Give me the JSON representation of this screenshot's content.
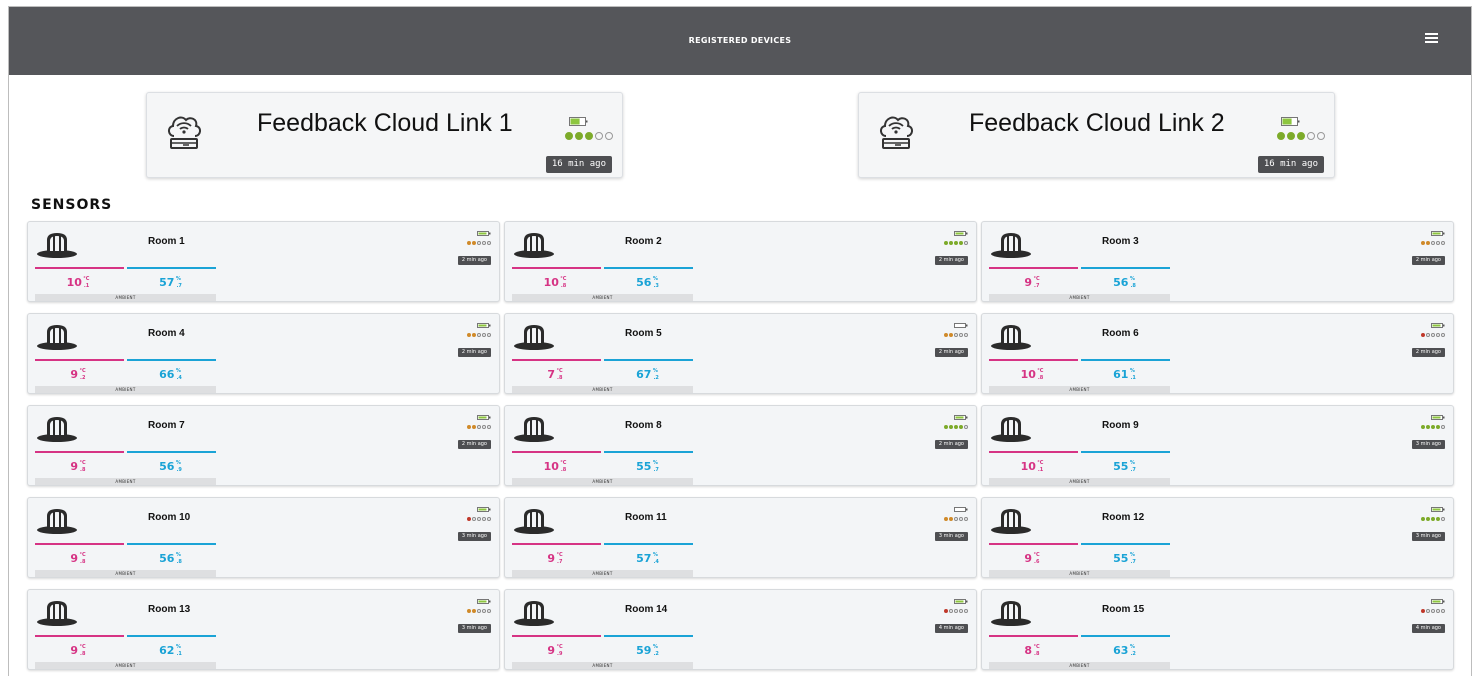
{
  "header": {
    "title": "REGISTERED DEVICES",
    "menu_icon": "hamburger-menu-icon"
  },
  "gateways": [
    {
      "name": "Feedback Cloud Link 1",
      "last_seen": "16 min ago",
      "battery": 0.7,
      "signal": 3,
      "icon": "cloud-wifi-router-icon"
    },
    {
      "name": "Feedback Cloud Link 2",
      "last_seen": "16 min ago",
      "battery": 0.7,
      "signal": 3,
      "icon": "cloud-wifi-router-icon"
    }
  ],
  "section_title": "SENSORS",
  "colors": {
    "temperature": "#d63384",
    "humidity": "#1aa3d6",
    "signal_green": "#7dab2a",
    "signal_orange": "#d08a2a",
    "signal_red": "#c0392b",
    "battery_green": "#8dc63f"
  },
  "sensors": [
    {
      "name": "Room 1",
      "temp": "10",
      "temp_dec": ".1",
      "temp_unit": "°C",
      "hum": "57",
      "hum_dec": ".7",
      "hum_unit": "%",
      "label": "AMBIENT",
      "last_seen": "2 min ago",
      "battery": 1.0,
      "signal": 2
    },
    {
      "name": "Room 2",
      "temp": "10",
      "temp_dec": ".8",
      "temp_unit": "°C",
      "hum": "56",
      "hum_dec": ".3",
      "hum_unit": "%",
      "label": "AMBIENT",
      "last_seen": "2 min ago",
      "battery": 1.0,
      "signal": 4
    },
    {
      "name": "Room 3",
      "temp": "9",
      "temp_dec": ".7",
      "temp_unit": "°C",
      "hum": "56",
      "hum_dec": ".8",
      "hum_unit": "%",
      "label": "AMBIENT",
      "last_seen": "2 min ago",
      "battery": 1.0,
      "signal": 2
    },
    {
      "name": "Room 4",
      "temp": "9",
      "temp_dec": ".2",
      "temp_unit": "°C",
      "hum": "66",
      "hum_dec": ".4",
      "hum_unit": "%",
      "label": "AMBIENT",
      "last_seen": "2 min ago",
      "battery": 1.0,
      "signal": 2
    },
    {
      "name": "Room 5",
      "temp": "7",
      "temp_dec": ".8",
      "temp_unit": "°C",
      "hum": "67",
      "hum_dec": ".2",
      "hum_unit": "%",
      "label": "AMBIENT",
      "last_seen": "2 min ago",
      "battery": 0.4,
      "signal": 2
    },
    {
      "name": "Room 6",
      "temp": "10",
      "temp_dec": ".8",
      "temp_unit": "°C",
      "hum": "61",
      "hum_dec": ".1",
      "hum_unit": "%",
      "label": "AMBIENT",
      "last_seen": "2 min ago",
      "battery": 1.0,
      "signal": 1
    },
    {
      "name": "Room 7",
      "temp": "9",
      "temp_dec": ".8",
      "temp_unit": "°C",
      "hum": "56",
      "hum_dec": ".9",
      "hum_unit": "%",
      "label": "AMBIENT",
      "last_seen": "2 min ago",
      "battery": 1.0,
      "signal": 2
    },
    {
      "name": "Room 8",
      "temp": "10",
      "temp_dec": ".8",
      "temp_unit": "°C",
      "hum": "55",
      "hum_dec": ".7",
      "hum_unit": "%",
      "label": "AMBIENT",
      "last_seen": "2 min ago",
      "battery": 1.0,
      "signal": 4
    },
    {
      "name": "Room 9",
      "temp": "10",
      "temp_dec": ".1",
      "temp_unit": "°C",
      "hum": "55",
      "hum_dec": ".7",
      "hum_unit": "%",
      "label": "AMBIENT",
      "last_seen": "3 min ago",
      "battery": 1.0,
      "signal": 4
    },
    {
      "name": "Room 10",
      "temp": "9",
      "temp_dec": ".8",
      "temp_unit": "°C",
      "hum": "56",
      "hum_dec": ".8",
      "hum_unit": "%",
      "label": "AMBIENT",
      "last_seen": "3 min ago",
      "battery": 1.0,
      "signal": 1
    },
    {
      "name": "Room 11",
      "temp": "9",
      "temp_dec": ".7",
      "temp_unit": "°C",
      "hum": "57",
      "hum_dec": ".4",
      "hum_unit": "%",
      "label": "AMBIENT",
      "last_seen": "3 min ago",
      "battery": 0.3,
      "signal": 2
    },
    {
      "name": "Room 12",
      "temp": "9",
      "temp_dec": ".6",
      "temp_unit": "°C",
      "hum": "55",
      "hum_dec": ".7",
      "hum_unit": "%",
      "label": "AMBIENT",
      "last_seen": "3 min ago",
      "battery": 1.0,
      "signal": 4
    },
    {
      "name": "Room 13",
      "temp": "9",
      "temp_dec": ".8",
      "temp_unit": "°C",
      "hum": "62",
      "hum_dec": ".1",
      "hum_unit": "%",
      "label": "AMBIENT",
      "last_seen": "3 min ago",
      "battery": 1.0,
      "signal": 2
    },
    {
      "name": "Room 14",
      "temp": "9",
      "temp_dec": ".9",
      "temp_unit": "°C",
      "hum": "59",
      "hum_dec": ".2",
      "hum_unit": "%",
      "label": "AMBIENT",
      "last_seen": "4 min ago",
      "battery": 1.0,
      "signal": 1
    },
    {
      "name": "Room 15",
      "temp": "8",
      "temp_dec": ".8",
      "temp_unit": "°C",
      "hum": "63",
      "hum_dec": ".2",
      "hum_unit": "%",
      "label": "AMBIENT",
      "last_seen": "4 min ago",
      "battery": 1.0,
      "signal": 1
    }
  ]
}
